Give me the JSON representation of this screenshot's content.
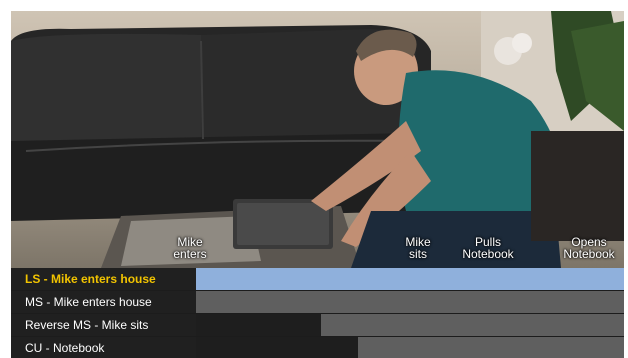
{
  "colors": {
    "active_label": "#f2c400",
    "active_bar": "#8fb0dc",
    "inactive_bar": "#5f5f5f",
    "label_bg": "#202020"
  },
  "markers": [
    {
      "label": "Mike\nenters",
      "position": 0.292
    },
    {
      "label": "Mike\nsits",
      "position": 0.664
    },
    {
      "label": "Pulls\nNotebook",
      "position": 0.778
    },
    {
      "label": "Opens\nNotebook",
      "position": 0.946
    }
  ],
  "tracks": [
    {
      "label": "LS - Mike enters house",
      "active": true,
      "start": 0.0,
      "end": 1.0
    },
    {
      "label": "MS - Mike enters house",
      "active": false,
      "start": 0.0,
      "end": 1.0
    },
    {
      "label": "Reverse MS - Mike sits",
      "active": false,
      "start": 0.292,
      "end": 1.0
    },
    {
      "label": "CU - Notebook",
      "active": false,
      "start": 0.378,
      "end": 1.0
    }
  ]
}
